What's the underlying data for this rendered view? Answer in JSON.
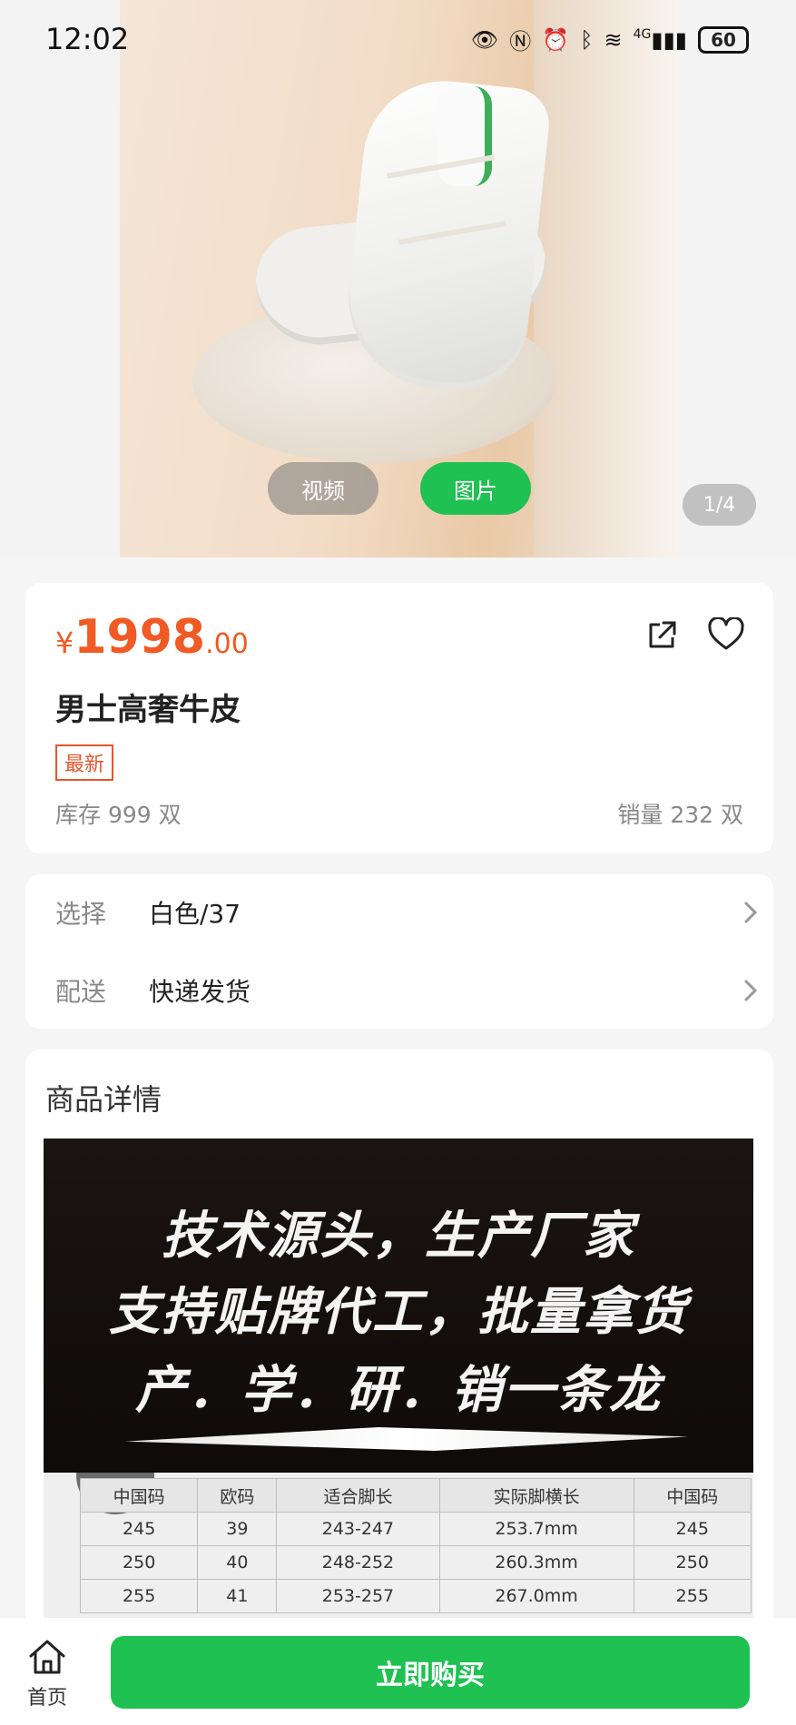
{
  "status_bar": {
    "time": "12:02",
    "signal_label": "4G",
    "battery": "60"
  },
  "gallery": {
    "tab_video": "视频",
    "tab_image": "图片",
    "counter": "1/4"
  },
  "product": {
    "price_symbol": "¥",
    "price_integer": "1998",
    "price_decimal": ".00",
    "title": "男士高奢牛皮",
    "badge": "最新",
    "stock": "库存 999 双",
    "sales": "销量 232 双"
  },
  "options": {
    "select_label": "选择",
    "select_value": "白色/37",
    "shipping_label": "配送",
    "shipping_value": "快递发货"
  },
  "details": {
    "heading": "商品详情",
    "poster_lines": [
      "技术源头，生产厂家",
      "支持贴牌代工，批量拿货",
      "产．学．研．销一条龙"
    ],
    "size_table": {
      "headers": [
        "中国码",
        "欧码",
        "适合脚长",
        "实际脚横长",
        "中国码"
      ],
      "rows": [
        [
          "245",
          "39",
          "243-247",
          "253.7mm",
          "245"
        ],
        [
          "250",
          "40",
          "248-252",
          "260.3mm",
          "250"
        ],
        [
          "255",
          "41",
          "253-257",
          "267.0mm",
          "255"
        ]
      ]
    }
  },
  "bottom_bar": {
    "home_label": "首页",
    "buy_label": "立即购买"
  },
  "colors": {
    "accent_green": "#1fc152",
    "price_orange": "#f05a24"
  }
}
